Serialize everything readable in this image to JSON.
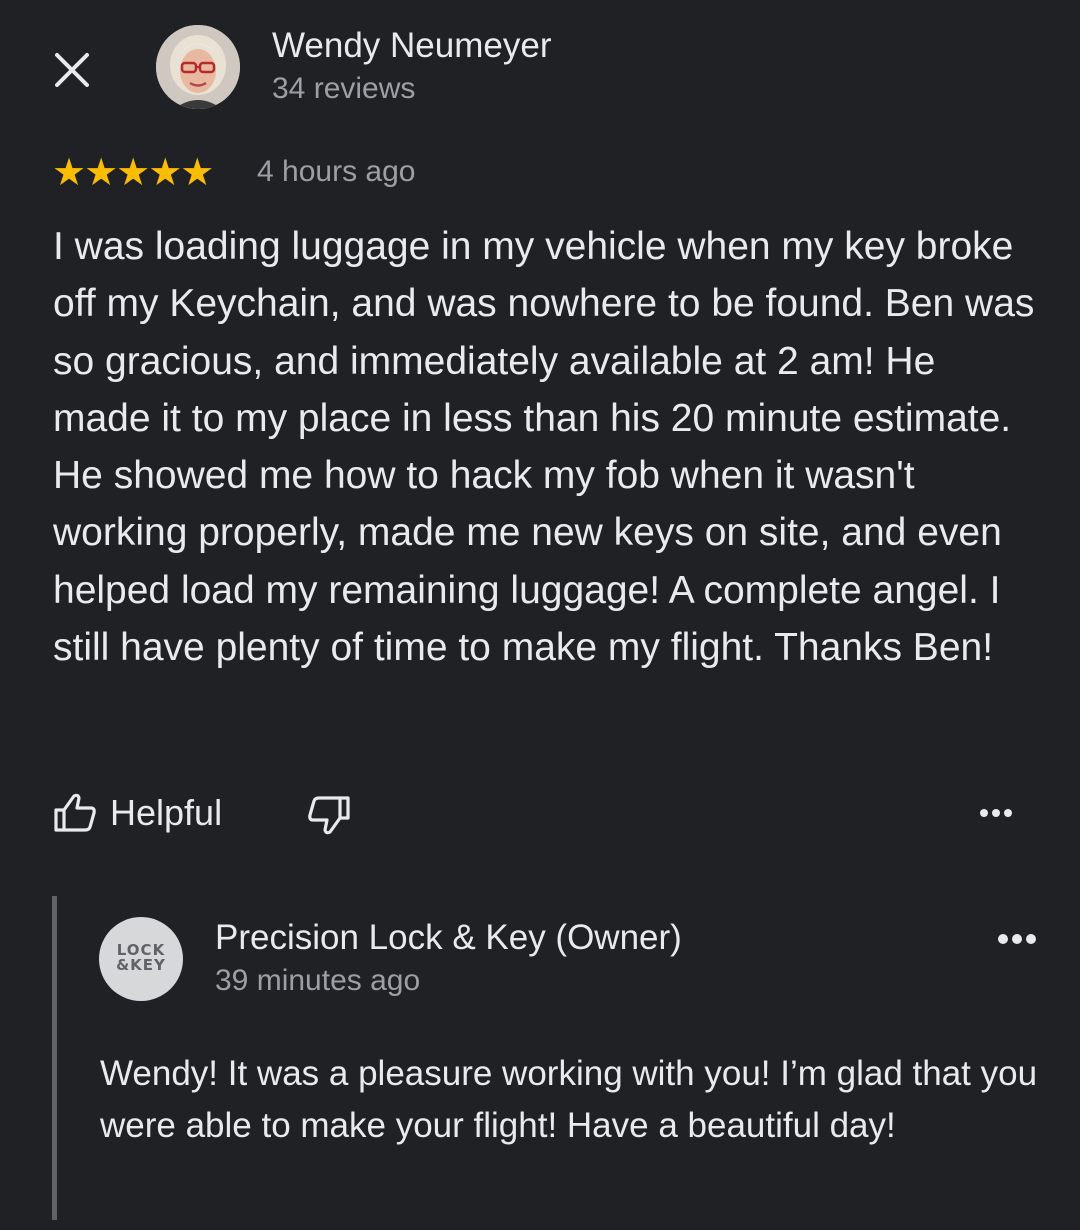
{
  "review": {
    "reviewer_name": "Wendy Neumeyer",
    "review_count": "34 reviews",
    "rating": 5,
    "stars": "★★★★★",
    "time_ago": "4 hours ago",
    "text": "I was loading luggage in my vehicle when my key broke off my Keychain, and was nowhere to be found. Ben was so gracious, and immediately available at 2 am! He made it to my place in less than his 20 minute estimate. He showed me how to hack my fob when it wasn't working properly, made me new keys on site, and even helped load my remaining luggage! A complete angel. I still have plenty of time to make my flight. Thanks Ben!"
  },
  "actions": {
    "helpful_label": "Helpful",
    "close_icon": "close-icon",
    "helpful_icon": "thumbs-up-icon",
    "not_helpful_icon": "thumbs-down-icon",
    "more_icon": "more-horizontal-icon"
  },
  "owner_response": {
    "name": "Precision Lock & Key (Owner)",
    "logo_text": "LOCK &KEY",
    "time_ago": "39 minutes ago",
    "text": "Wendy! It was a pleasure working with you! I’m glad that you were able to make your flight! Have a beautiful day!"
  },
  "colors": {
    "background": "#202124",
    "primary_text": "#e8eaed",
    "secondary_text": "#9aa0a6",
    "star": "#fbbc04",
    "divider": "#5f6368"
  }
}
